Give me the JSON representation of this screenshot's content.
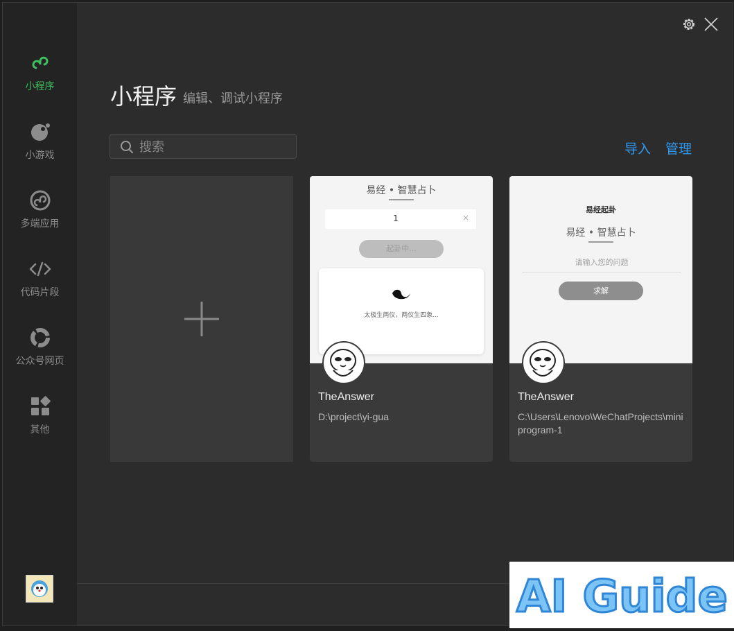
{
  "sidebar": {
    "items": [
      {
        "label": "小程序",
        "icon": "mini-program-icon",
        "active": true
      },
      {
        "label": "小游戏",
        "icon": "mini-game-icon"
      },
      {
        "label": "多端应用",
        "icon": "multi-platform-icon"
      },
      {
        "label": "代码片段",
        "icon": "code-icon"
      },
      {
        "label": "公众号网页",
        "icon": "official-account-icon"
      },
      {
        "label": "其他",
        "icon": "other-apps-icon"
      }
    ]
  },
  "header": {
    "title": "小程序",
    "subtitle": "编辑、调试小程序"
  },
  "search": {
    "placeholder": "搜索"
  },
  "actions": {
    "import_label": "导入",
    "manage_label": "管理"
  },
  "projects": [
    {
      "name": "TheAnswer",
      "path": "D:\\project\\yi-gua",
      "preview": {
        "title": "易经 • 智慧占卜",
        "input_value": "1",
        "button_label": "起卦中...",
        "quote": "太极生两仪，两仪生四象..."
      }
    },
    {
      "name": "TheAnswer",
      "path": "C:\\Users\\Lenovo\\WeChatProjects\\miniprogram-1",
      "preview": {
        "heading": "易经起卦",
        "title": "易经 • 智慧占卜",
        "input_placeholder": "请输入您的问题",
        "button_label": "求解"
      }
    }
  ],
  "watermark": {
    "text": "AI Guide"
  },
  "colors": {
    "accent_green": "#3fbf5f",
    "link_blue": "#2f9bf0",
    "background": "#2c2c2c"
  }
}
